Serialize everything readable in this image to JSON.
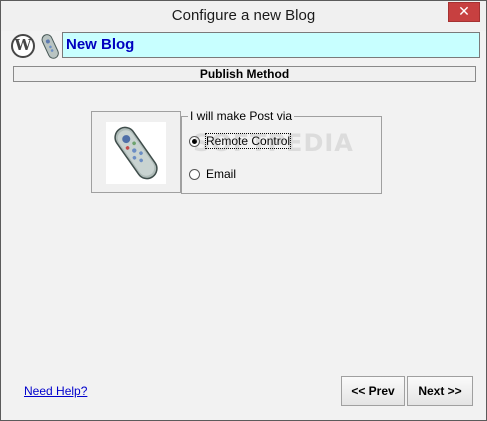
{
  "window": {
    "title": "Configure a new Blog",
    "close_glyph": "✕"
  },
  "header": {
    "logo_letter": "W",
    "blog_name": "New Blog"
  },
  "section": {
    "title": "Publish Method"
  },
  "group": {
    "legend": "I will make Post via",
    "options": [
      {
        "label": "Remote Control",
        "selected": true
      },
      {
        "label": "Email",
        "selected": false
      }
    ]
  },
  "watermark": "SOFTPEDIA",
  "footer": {
    "help_link": "Need Help?",
    "prev_label": "<< Prev",
    "next_label": "Next >>"
  },
  "icons": [
    "wordpress-logo-icon",
    "remote-control-icon",
    "close-icon"
  ]
}
